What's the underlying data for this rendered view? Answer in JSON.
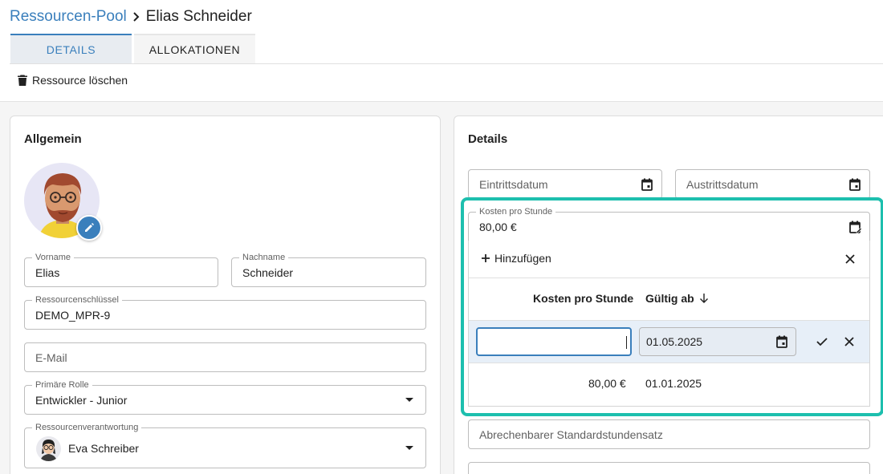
{
  "breadcrumb": {
    "parent": "Ressourcen-Pool",
    "current": "Elias Schneider"
  },
  "tabs": [
    {
      "label": "DETAILS"
    },
    {
      "label": "ALLOKATIONEN"
    }
  ],
  "toolbar": {
    "delete_label": "Ressource löschen"
  },
  "left_card": {
    "title": "Allgemein",
    "vorname": {
      "label": "Vorname",
      "value": "Elias"
    },
    "nachname": {
      "label": "Nachname",
      "value": "Schneider"
    },
    "key": {
      "label": "Ressourcenschlüssel",
      "value": "DEMO_MPR-9"
    },
    "email": {
      "placeholder": "E-Mail"
    },
    "role": {
      "label": "Primäre Rolle",
      "value": "Entwickler - Junior"
    },
    "owner": {
      "label": "Ressourcenverantwortung",
      "value": "Eva Schreiber"
    }
  },
  "right_card": {
    "title": "Details",
    "eintritt": {
      "placeholder": "Eintrittsdatum"
    },
    "austritt": {
      "placeholder": "Austrittsdatum"
    },
    "kosten": {
      "label": "Kosten pro Stunde",
      "value": "80,00 €"
    },
    "abrechenbar": {
      "placeholder": "Abrechenbarer Standardstundensatz"
    }
  },
  "popup": {
    "add_label": "Hinzufügen",
    "columns": {
      "cost": "Kosten pro Stunde",
      "valid_from": "Gültig ab"
    },
    "edit_row": {
      "cost": "",
      "valid_from": "01.05.2025"
    },
    "rows": [
      {
        "cost": "80,00 €",
        "valid_from": "01.01.2025"
      }
    ]
  },
  "colors": {
    "accent": "#3a7fbc",
    "highlight": "#1dbfae",
    "row_selected": "#e7eff8"
  },
  "icons": [
    "chevron-right-icon",
    "trash-icon",
    "pencil-icon",
    "calendar-icon",
    "calendar-edit-icon",
    "plus-icon",
    "close-icon",
    "arrow-down-icon",
    "check-icon",
    "dropdown-arrow-icon"
  ]
}
